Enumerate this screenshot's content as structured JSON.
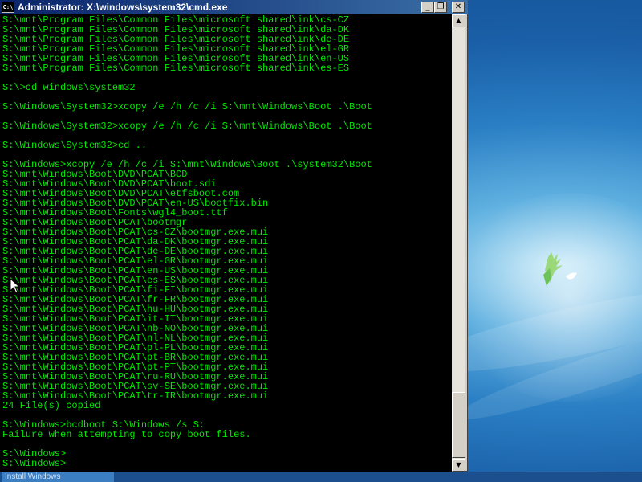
{
  "window": {
    "title": "Administrator: X:\\windows\\system32\\cmd.exe",
    "icon_label": "C:\\",
    "minimize_icon": "_",
    "maximize_icon": "❐",
    "close_icon": "✕"
  },
  "console_lines": [
    "S:\\mnt\\Program Files\\Common Files\\microsoft shared\\ink\\cs-CZ",
    "S:\\mnt\\Program Files\\Common Files\\microsoft shared\\ink\\da-DK",
    "S:\\mnt\\Program Files\\Common Files\\microsoft shared\\ink\\de-DE",
    "S:\\mnt\\Program Files\\Common Files\\microsoft shared\\ink\\el-GR",
    "S:\\mnt\\Program Files\\Common Files\\microsoft shared\\ink\\en-US",
    "S:\\mnt\\Program Files\\Common Files\\microsoft shared\\ink\\es-ES",
    "",
    "S:\\>cd windows\\system32",
    "",
    "S:\\Windows\\System32>xcopy /e /h /c /i S:\\mnt\\Windows\\Boot .\\Boot",
    "",
    "S:\\Windows\\System32>xcopy /e /h /c /i S:\\mnt\\Windows\\Boot .\\Boot",
    "",
    "S:\\Windows\\System32>cd ..",
    "",
    "S:\\Windows>xcopy /e /h /c /i S:\\mnt\\Windows\\Boot .\\system32\\Boot",
    "S:\\mnt\\Windows\\Boot\\DVD\\PCAT\\BCD",
    "S:\\mnt\\Windows\\Boot\\DVD\\PCAT\\boot.sdi",
    "S:\\mnt\\Windows\\Boot\\DVD\\PCAT\\etfsboot.com",
    "S:\\mnt\\Windows\\Boot\\DVD\\PCAT\\en-US\\bootfix.bin",
    "S:\\mnt\\Windows\\Boot\\Fonts\\wgl4_boot.ttf",
    "S:\\mnt\\Windows\\Boot\\PCAT\\bootmgr",
    "S:\\mnt\\Windows\\Boot\\PCAT\\cs-CZ\\bootmgr.exe.mui",
    "S:\\mnt\\Windows\\Boot\\PCAT\\da-DK\\bootmgr.exe.mui",
    "S:\\mnt\\Windows\\Boot\\PCAT\\de-DE\\bootmgr.exe.mui",
    "S:\\mnt\\Windows\\Boot\\PCAT\\el-GR\\bootmgr.exe.mui",
    "S:\\mnt\\Windows\\Boot\\PCAT\\en-US\\bootmgr.exe.mui",
    "S:\\mnt\\Windows\\Boot\\PCAT\\es-ES\\bootmgr.exe.mui",
    "S:\\mnt\\Windows\\Boot\\PCAT\\fi-FI\\bootmgr.exe.mui",
    "S:\\mnt\\Windows\\Boot\\PCAT\\fr-FR\\bootmgr.exe.mui",
    "S:\\mnt\\Windows\\Boot\\PCAT\\hu-HU\\bootmgr.exe.mui",
    "S:\\mnt\\Windows\\Boot\\PCAT\\it-IT\\bootmgr.exe.mui",
    "S:\\mnt\\Windows\\Boot\\PCAT\\nb-NO\\bootmgr.exe.mui",
    "S:\\mnt\\Windows\\Boot\\PCAT\\nl-NL\\bootmgr.exe.mui",
    "S:\\mnt\\Windows\\Boot\\PCAT\\pl-PL\\bootmgr.exe.mui",
    "S:\\mnt\\Windows\\Boot\\PCAT\\pt-BR\\bootmgr.exe.mui",
    "S:\\mnt\\Windows\\Boot\\PCAT\\pt-PT\\bootmgr.exe.mui",
    "S:\\mnt\\Windows\\Boot\\PCAT\\ru-RU\\bootmgr.exe.mui",
    "S:\\mnt\\Windows\\Boot\\PCAT\\sv-SE\\bootmgr.exe.mui",
    "S:\\mnt\\Windows\\Boot\\PCAT\\tr-TR\\bootmgr.exe.mui",
    "24 File(s) copied",
    "",
    "S:\\Windows>bcdboot S:\\Windows /s S:",
    "Failure when attempting to copy boot files.",
    "",
    "S:\\Windows>",
    "S:\\Windows>"
  ],
  "scrollbar": {
    "up_icon": "▲",
    "down_icon": "▼"
  },
  "taskbar": {
    "install_label": "Install Windows"
  },
  "colors": {
    "console_text": "#00e800",
    "console_bg": "#000000",
    "title_bar": "#0a246a"
  }
}
